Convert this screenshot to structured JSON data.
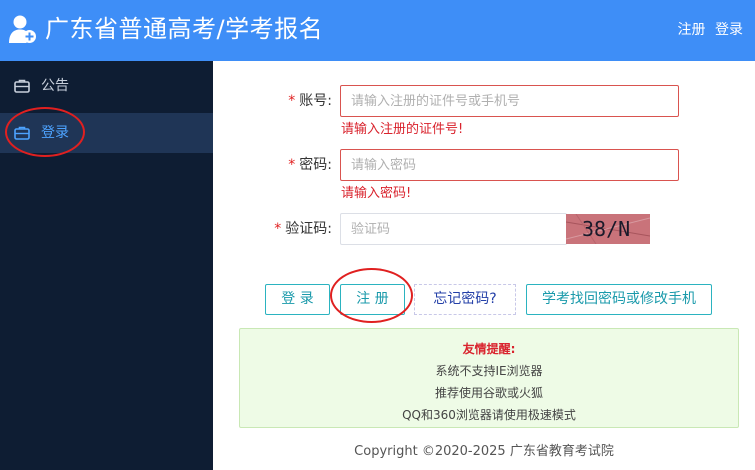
{
  "header": {
    "title": "广东省普通高考/学考报名",
    "register_link": "注册",
    "login_link": "登录"
  },
  "sidebar": {
    "items": [
      {
        "label": "公告",
        "icon": "briefcase-icon"
      },
      {
        "label": "登录",
        "icon": "briefcase-icon",
        "active": true
      }
    ]
  },
  "form": {
    "account": {
      "label": "账号:",
      "placeholder": "请输入注册的证件号或手机号",
      "error": "请输入注册的证件号!"
    },
    "password": {
      "label": "密码:",
      "placeholder": "请输入密码",
      "error": "请输入密码!"
    },
    "captcha": {
      "label": "验证码:",
      "placeholder": "验证码",
      "image_text": "38/N"
    }
  },
  "buttons": {
    "login": "登 录",
    "register": "注 册",
    "forgot_password": "忘记密码?",
    "recover": "学考找回密码或修改手机"
  },
  "notice": {
    "title": "友情提醒:",
    "lines": [
      "系统不支持IE浏览器",
      "推荐使用谷歌或火狐",
      "QQ和360浏览器请使用极速模式"
    ]
  },
  "footer": {
    "copyright": "Copyright ©2020-2025 广东省教育考试院"
  },
  "colors": {
    "header_bg": "#3e8ef7",
    "sidebar_bg": "#0e1d33",
    "sidebar_active_bg": "#1f3556",
    "accent": "#4da3ff",
    "error": "#d9232d",
    "button_border": "#2bb3c0"
  }
}
